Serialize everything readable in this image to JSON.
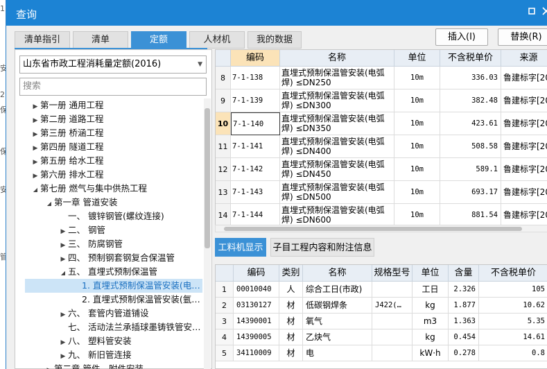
{
  "background": {
    "edge_texts": [
      "1",
      "安",
      "2",
      "保",
      "保",
      "安",
      "管"
    ]
  },
  "dialog": {
    "title": "查询",
    "restore_icon": "restore-icon",
    "close_icon": "close-icon"
  },
  "tabs": [
    {
      "label": "清单指引",
      "active": false
    },
    {
      "label": "清单",
      "active": false
    },
    {
      "label": "定额",
      "active": true
    },
    {
      "label": "人材机",
      "active": false
    },
    {
      "label": "我的数据",
      "active": false
    }
  ],
  "actions": {
    "insert_label": "插入(I)",
    "replace_label": "替换(R)"
  },
  "left": {
    "library_select": "山东省市政工程消耗量定额(2016)",
    "search_placeholder": "搜索",
    "tree": [
      {
        "label": "第一册 通用工程",
        "level": 0,
        "expand": "collapsed"
      },
      {
        "label": "第二册 道路工程",
        "level": 0,
        "expand": "collapsed"
      },
      {
        "label": "第三册 桥涵工程",
        "level": 0,
        "expand": "collapsed"
      },
      {
        "label": "第四册 隧道工程",
        "level": 0,
        "expand": "collapsed"
      },
      {
        "label": "第五册 给水工程",
        "level": 0,
        "expand": "collapsed"
      },
      {
        "label": "第六册 排水工程",
        "level": 0,
        "expand": "collapsed"
      },
      {
        "label": "第七册 燃气与集中供热工程",
        "level": 0,
        "expand": "expanded"
      },
      {
        "label": "第一章 管道安装",
        "level": 1,
        "expand": "expanded"
      },
      {
        "label": "一、 镀锌钢管(螺纹连接)",
        "level": 2,
        "expand": "none"
      },
      {
        "label": "二、 钢管",
        "level": 2,
        "expand": "collapsed"
      },
      {
        "label": "三、 防腐钢管",
        "level": 2,
        "expand": "collapsed"
      },
      {
        "label": "四、 预制钢套钢复合保温管",
        "level": 2,
        "expand": "collapsed"
      },
      {
        "label": "五、 直埋式预制保温管",
        "level": 2,
        "expand": "expanded"
      },
      {
        "label": "1. 直埋式预制保温管安装(电…",
        "level": 3,
        "expand": "none",
        "selected": true
      },
      {
        "label": "2. 直埋式预制保温管安装(氩…",
        "level": 3,
        "expand": "none"
      },
      {
        "label": "六、 套管内管道铺设",
        "level": 2,
        "expand": "collapsed"
      },
      {
        "label": "七、 活动法兰承插球墨铸铁管安…",
        "level": 2,
        "expand": "none"
      },
      {
        "label": "八、 塑料管安装",
        "level": 2,
        "expand": "collapsed"
      },
      {
        "label": "九、 新旧管连接",
        "level": 2,
        "expand": "collapsed"
      },
      {
        "label": "第二章 管件、附件安装",
        "level": 1,
        "expand": "collapsed"
      }
    ]
  },
  "top_grid": {
    "headers": [
      "",
      "编码",
      "名称",
      "单位",
      "不含税单价",
      "来源"
    ],
    "rows": [
      {
        "no": "8",
        "code": "7-1-138",
        "name": "直埋式预制保温管安装(电弧焊) ≤DN250",
        "unit": "10m",
        "price": "336.03",
        "source": "鲁建标字[201"
      },
      {
        "no": "9",
        "code": "7-1-139",
        "name": "直埋式预制保温管安装(电弧焊) ≤DN300",
        "unit": "10m",
        "price": "382.48",
        "source": "鲁建标字[201"
      },
      {
        "no": "10",
        "code": "7-1-140",
        "name": "直埋式预制保温管安装(电弧焊) ≤DN350",
        "unit": "10m",
        "price": "423.61",
        "source": "鲁建标字[201",
        "selected": true
      },
      {
        "no": "11",
        "code": "7-1-141",
        "name": "直埋式预制保温管安装(电弧焊) ≤DN400",
        "unit": "10m",
        "price": "508.58",
        "source": "鲁建标字[201"
      },
      {
        "no": "12",
        "code": "7-1-142",
        "name": "直埋式预制保温管安装(电弧焊) ≤DN450",
        "unit": "10m",
        "price": "589.1",
        "source": "鲁建标字[201"
      },
      {
        "no": "13",
        "code": "7-1-143",
        "name": "直埋式预制保温管安装(电弧焊) ≤DN500",
        "unit": "10m",
        "price": "693.17",
        "source": "鲁建标字[201"
      },
      {
        "no": "14",
        "code": "7-1-144",
        "name": "直埋式预制保温管安装(电弧焊) ≤DN600",
        "unit": "10m",
        "price": "881.54",
        "source": "鲁建标字[201"
      }
    ]
  },
  "bottom_tabs": [
    {
      "label": "工料机显示",
      "active": true
    },
    {
      "label": "子目工程内容和附注信息",
      "active": false
    }
  ],
  "bottom_grid": {
    "headers": [
      "",
      "编码",
      "类别",
      "名称",
      "规格型号",
      "单位",
      "含量",
      "不含税单价"
    ],
    "rows": [
      {
        "no": "1",
        "code": "00010040",
        "type": "人",
        "name": "综合工日(市政)",
        "spec": "",
        "unit": "工日",
        "qty": "2.326",
        "price": "105"
      },
      {
        "no": "2",
        "code": "03130127",
        "type": "材",
        "name": "低碳钢焊条",
        "spec": "J422(…",
        "unit": "kg",
        "qty": "1.877",
        "price": "10.62"
      },
      {
        "no": "3",
        "code": "14390001",
        "type": "材",
        "name": "氧气",
        "spec": "",
        "unit": "m3",
        "qty": "1.363",
        "price": "5.35"
      },
      {
        "no": "4",
        "code": "14390005",
        "type": "材",
        "name": "乙炔气",
        "spec": "",
        "unit": "kg",
        "qty": "0.454",
        "price": "14.61"
      },
      {
        "no": "5",
        "code": "34110009",
        "type": "材",
        "name": "电",
        "spec": "",
        "unit": "kW·h",
        "qty": "0.278",
        "price": "0.8"
      }
    ]
  },
  "colors": {
    "titlebar": "#1c83d4",
    "active_tab": "#3b91d6",
    "selected_row": "#fbe3b8",
    "tree_selected": "#cce4f7"
  }
}
